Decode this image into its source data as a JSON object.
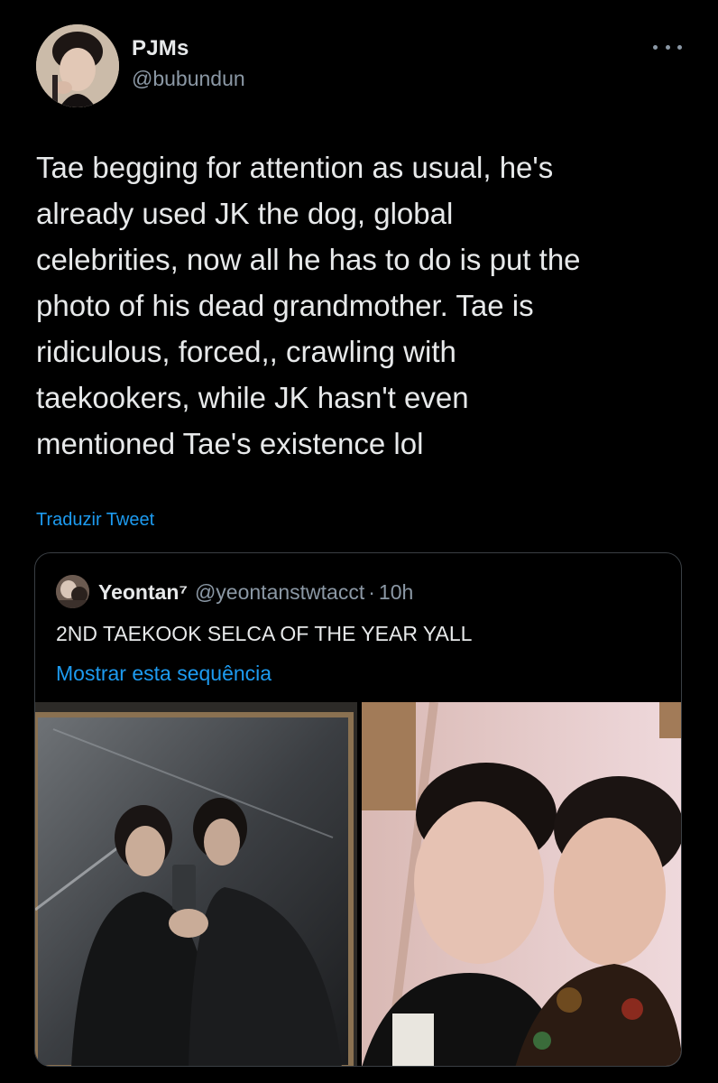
{
  "tweet": {
    "display_name": "PJMs",
    "handle": "@bubundun",
    "text": "Tae begging for attention as usual, he's\nalready used JK the dog, global\ncelebrities, now all he has to do is put the\nphoto of his dead grandmother. Tae is\nridiculous, forced,, crawling with\ntaekookers, while JK hasn't even\nmentioned Tae's existence lol",
    "translate_label": "Traduzir Tweet",
    "more_icon": "more-horizontal-icon"
  },
  "quote": {
    "display_name": "Yeontan⁷",
    "handle": "@yeontanstwtacct",
    "separator": "·",
    "time": "10h",
    "text": "2ND TAEKOOK SELCA OF THE YEAR YALL",
    "thread_label": "Mostrar esta sequência"
  },
  "colors": {
    "background": "#000000",
    "text": "#e7e9ea",
    "secondary": "#8b98a5",
    "link": "#1d9bf0",
    "border": "#3a3f44"
  }
}
